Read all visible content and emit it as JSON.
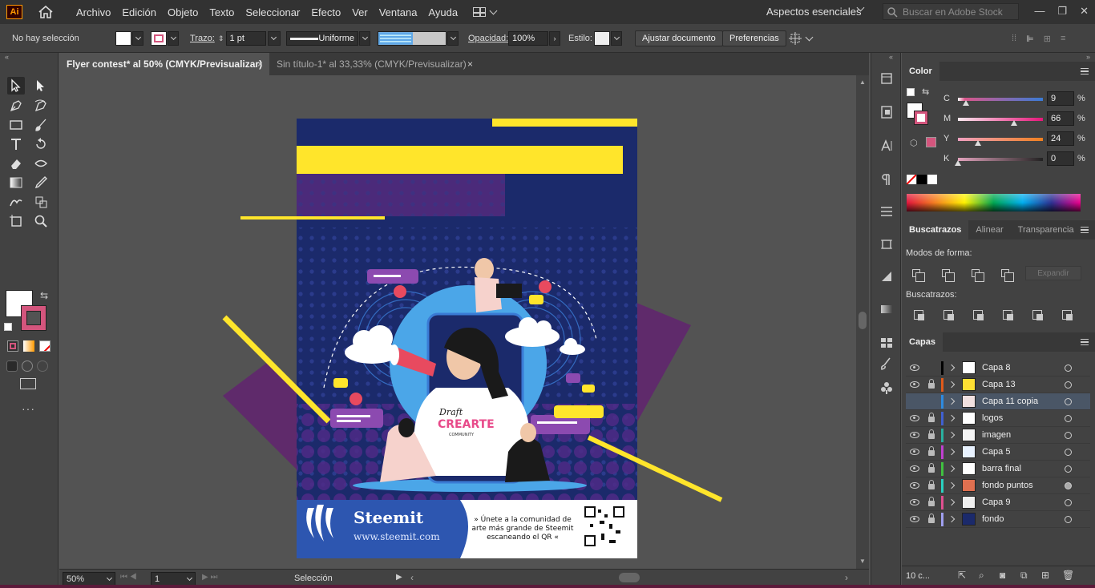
{
  "app": {
    "logo": "Ai"
  },
  "menu": [
    "Archivo",
    "Edición",
    "Objeto",
    "Texto",
    "Seleccionar",
    "Efecto",
    "Ver",
    "Ventana",
    "Ayuda"
  ],
  "workspace": "Aspectos esenciales",
  "stock_search_placeholder": "Buscar en Adobe Stock",
  "control": {
    "selection": "No hay selección",
    "stroke_label": "Trazo:",
    "stroke_value": "1 pt",
    "profile": "Uniforme",
    "opacity_label": "Opacidad:",
    "opacity_value": "100%",
    "style_label": "Estilo:",
    "fit_doc": "Ajustar documento",
    "prefs": "Preferencias"
  },
  "tabs": [
    {
      "label": "Flyer contest* al 50% (CMYK/Previsualizar)",
      "close": "×"
    },
    {
      "label": "Sin título-1* al 33,33% (CMYK/Previsualizar)",
      "close": "×"
    }
  ],
  "status": {
    "zoom": "50%",
    "page": "1",
    "tool": "Selección"
  },
  "color_panel": {
    "title": "Color",
    "channels": [
      {
        "name": "C",
        "value": "9",
        "frac": 0.09
      },
      {
        "name": "M",
        "value": "66",
        "frac": 0.66
      },
      {
        "name": "Y",
        "value": "24",
        "frac": 0.24
      },
      {
        "name": "K",
        "value": "0",
        "frac": 0.0
      }
    ],
    "percent": "%"
  },
  "pathfinder": {
    "tabs": [
      "Buscatrazos",
      "Alinear",
      "Transparencia"
    ],
    "shape_modes": "Modos de forma:",
    "expand": "Expandir",
    "pathfinders": "Buscatrazos:"
  },
  "layers": {
    "title": "Capas",
    "footer_count": "10 c...",
    "items": [
      {
        "name": "Capa 8",
        "color": "#000000",
        "visible": true,
        "locked": false,
        "selected": false,
        "thumb": "#ffffff"
      },
      {
        "name": "Capa 13",
        "color": "#e05a1a",
        "visible": true,
        "locked": true,
        "selected": false,
        "thumb": "#ffe033"
      },
      {
        "name": "Capa 11 copia",
        "color": "#2e8be0",
        "visible": false,
        "locked": false,
        "selected": true,
        "thumb": "#f0e0e0"
      },
      {
        "name": "logos",
        "color": "#4060d0",
        "visible": true,
        "locked": true,
        "selected": false,
        "thumb": "#ffffff"
      },
      {
        "name": "imagen",
        "color": "#2ab0a0",
        "visible": true,
        "locked": true,
        "selected": false,
        "thumb": "#f5f5f5"
      },
      {
        "name": "Capa 5",
        "color": "#c040d0",
        "visible": true,
        "locked": true,
        "selected": false,
        "thumb": "#e8f2ff"
      },
      {
        "name": "barra final",
        "color": "#40c040",
        "visible": true,
        "locked": true,
        "selected": false,
        "thumb": "#ffffff"
      },
      {
        "name": "fondo puntos",
        "color": "#2ad0c0",
        "visible": true,
        "locked": true,
        "selected": false,
        "thumb": "#e07050"
      },
      {
        "name": "Capa 9",
        "color": "#e05090",
        "visible": true,
        "locked": true,
        "selected": false,
        "thumb": "#f0f0f0"
      },
      {
        "name": "fondo",
        "color": "#a0a0f0",
        "visible": true,
        "locked": true,
        "selected": false,
        "thumb": "#1b2a6b"
      }
    ]
  },
  "artwork": {
    "brand": "Steemit",
    "url": "www.steemit.com",
    "cta": "» Únete a la comunidad de arte más grande de Steemit escaneando el QR «",
    "logo_word1": "Draft",
    "logo_word2": "CREARTE",
    "logo_word3": "COMMUNITY"
  }
}
